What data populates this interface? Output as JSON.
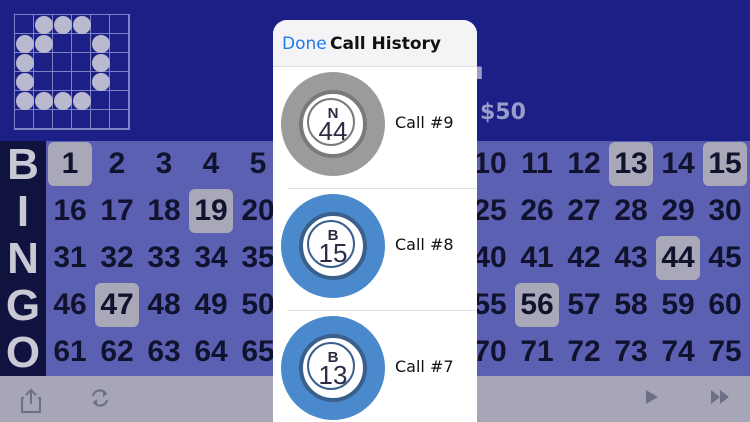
{
  "header": {
    "current_number_partial": "44",
    "prize": "$50",
    "pattern": [
      [
        0,
        1,
        1,
        1,
        0,
        0
      ],
      [
        1,
        1,
        0,
        0,
        1,
        0
      ],
      [
        1,
        0,
        0,
        0,
        1,
        0
      ],
      [
        1,
        0,
        0,
        0,
        1,
        0
      ],
      [
        1,
        1,
        1,
        1,
        0,
        0
      ]
    ]
  },
  "board": {
    "letters": [
      "B",
      "I",
      "N",
      "G",
      "O"
    ],
    "rows": [
      {
        "numbers": [
          "1",
          "2",
          "3",
          "4",
          "5"
        ],
        "right": [
          "10",
          "11",
          "12",
          "13",
          "14",
          "15"
        ],
        "called_left": [
          0
        ],
        "called_right": [
          3,
          5
        ]
      },
      {
        "numbers": [
          "16",
          "17",
          "18",
          "19",
          "20"
        ],
        "right": [
          "25",
          "26",
          "27",
          "28",
          "29",
          "30"
        ],
        "called_left": [
          3
        ],
        "called_right": []
      },
      {
        "numbers": [
          "31",
          "32",
          "33",
          "34",
          "35"
        ],
        "right": [
          "40",
          "41",
          "42",
          "43",
          "44",
          "45"
        ],
        "called_left": [],
        "called_right": [
          4
        ]
      },
      {
        "numbers": [
          "46",
          "47",
          "48",
          "49",
          "50"
        ],
        "right": [
          "55",
          "56",
          "57",
          "58",
          "59",
          "60"
        ],
        "called_left": [
          1
        ],
        "called_right": [
          1
        ]
      },
      {
        "numbers": [
          "61",
          "62",
          "63",
          "64",
          "65"
        ],
        "right": [
          "70",
          "71",
          "72",
          "73",
          "74",
          "75"
        ],
        "called_left": [],
        "called_right": []
      }
    ]
  },
  "toolbar": {
    "icons": [
      "share-icon",
      "refresh-icon",
      "play-icon",
      "fast-forward-icon"
    ]
  },
  "modal": {
    "done_label": "Done",
    "title": "Call History",
    "calls": [
      {
        "letter": "N",
        "number": "44",
        "label": "Call #9",
        "color": "#9b9b9b",
        "ring": "#7a7a7a"
      },
      {
        "letter": "B",
        "number": "15",
        "label": "Call #8",
        "color": "#4a89cc",
        "ring": "#3a5f8c"
      },
      {
        "letter": "B",
        "number": "13",
        "label": "Call #7",
        "color": "#4a89cc",
        "ring": "#3a5f8c"
      }
    ]
  },
  "colors": {
    "header_bg": "#1c1f86",
    "board_bg": "#5b60b3",
    "called_bg": "#a8a8b8",
    "link": "#1f7ce8"
  }
}
